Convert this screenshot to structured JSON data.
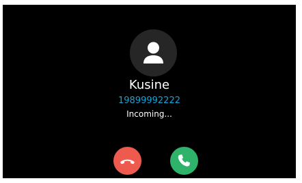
{
  "call": {
    "name": "Kusine",
    "number": "19899992222",
    "status": "Incoming..."
  },
  "icons": {
    "avatar": "person-icon",
    "decline": "phone-hangup-icon",
    "accept": "phone-icon"
  },
  "colors": {
    "background": "#000000",
    "avatar_circle": "#262626",
    "number": "#16a3d8",
    "decline": "#ef5a4f",
    "accept": "#2fb36a"
  }
}
